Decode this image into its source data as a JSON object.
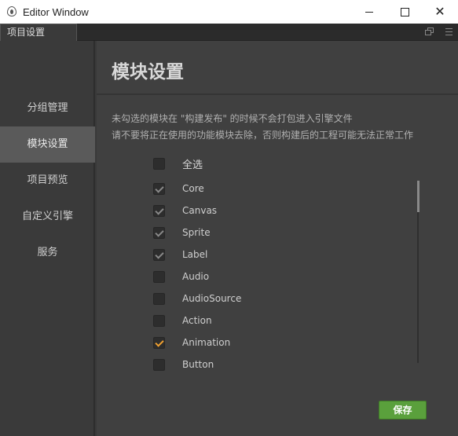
{
  "window": {
    "title": "Editor Window",
    "icons": {
      "app": "app-drop-icon",
      "minimize": "minimize-icon",
      "maximize": "maximize-icon",
      "close": "close-icon"
    },
    "close_glyph": "✕"
  },
  "tabs": [
    {
      "label": "项目设置"
    }
  ],
  "tab_tools": {
    "popout_icon": "popout-icon",
    "menu_icon": "menu-icon"
  },
  "sidebar": {
    "items": [
      {
        "label": "分组管理",
        "active": false
      },
      {
        "label": "模块设置",
        "active": true
      },
      {
        "label": "项目预览",
        "active": false
      },
      {
        "label": "自定义引擎",
        "active": false
      },
      {
        "label": "服务",
        "active": false
      }
    ]
  },
  "main": {
    "title": "模块设置",
    "description": [
      "未勾选的模块在 \"构建发布\" 的时候不会打包进入引擎文件",
      "请不要将正在使用的功能模块去除，否则构建后的工程可能无法正常工作"
    ],
    "select_all": {
      "label": "全选",
      "checked": false
    },
    "modules": [
      {
        "name": "Core",
        "checked": true
      },
      {
        "name": "Canvas",
        "checked": true
      },
      {
        "name": "Sprite",
        "checked": true
      },
      {
        "name": "Label",
        "checked": true
      },
      {
        "name": "Audio",
        "checked": false
      },
      {
        "name": "AudioSource",
        "checked": false
      },
      {
        "name": "Action",
        "checked": false
      },
      {
        "name": "Animation",
        "checked": true,
        "highlight": true
      },
      {
        "name": "Button",
        "checked": false
      }
    ],
    "save_label": "保存"
  },
  "colors": {
    "accent_check": "#f0a030",
    "save_button": "#5aa03c",
    "active_nav": "#5a5a5a"
  }
}
